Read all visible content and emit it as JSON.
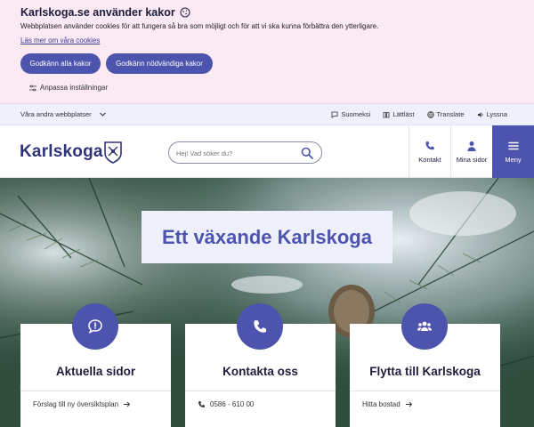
{
  "cookie": {
    "title": "Karlskoga.se använder kakor",
    "description": "Webbplatsen använder cookies för att fungera så bra som möjligt och för att vi ska kunna förbättra den ytterligare.",
    "more_link": "Läs mer om våra cookies",
    "accept_all": "Godkänn alla kakor",
    "accept_necessary": "Godkänn nödvändiga kakor",
    "adjust": "Anpassa inställningar"
  },
  "utility": {
    "other_sites": "Våra andra webbplatser",
    "tools": [
      {
        "label": "Suomeksi",
        "icon": "chat-icon"
      },
      {
        "label": "Lättläst",
        "icon": "book-icon"
      },
      {
        "label": "Translate",
        "icon": "globe-icon"
      },
      {
        "label": "Lyssna",
        "icon": "speaker-icon"
      }
    ]
  },
  "header": {
    "logo": "Karlskoga",
    "search_placeholder": "Hej! Vad söker du?",
    "kontakt": "Kontakt",
    "mina_sidor": "Mina sidor",
    "meny": "Meny"
  },
  "hero": {
    "title": "Ett växande Karlskoga"
  },
  "cards": [
    {
      "title": "Aktuella sidor",
      "link": "Förslag till ny översiktsplan",
      "icon": "speech-bubble-exclamation-icon"
    },
    {
      "title": "Kontakta oss",
      "link": "0586 - 610 00",
      "icon": "phone-icon"
    },
    {
      "title": "Flytta till Karlskoga",
      "link": "Hitta bostad",
      "icon": "group-icon"
    }
  ],
  "colors": {
    "brand": "#4d54ad",
    "cookie_bg": "#fbe9f4",
    "utility_bg": "#eef0fb",
    "text": "#1d1d3b"
  }
}
